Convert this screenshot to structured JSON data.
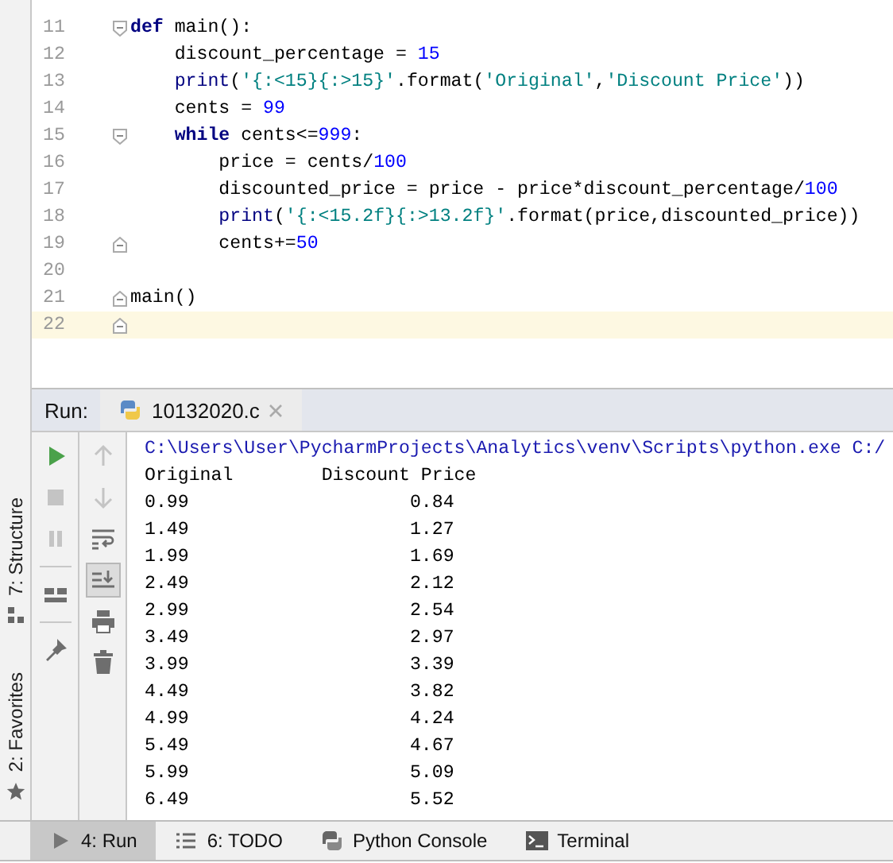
{
  "editor": {
    "lines": [
      {
        "number": "11",
        "fold_start": true,
        "fold_end": false,
        "current": false,
        "tokens": [
          {
            "kind": "keyword",
            "text": "def"
          },
          {
            "kind": "plain",
            "text": " main():"
          }
        ]
      },
      {
        "number": "12",
        "fold_start": false,
        "fold_end": false,
        "current": false,
        "tokens": [
          {
            "kind": "plain",
            "text": "    discount_percentage = "
          },
          {
            "kind": "number",
            "text": "15"
          }
        ]
      },
      {
        "number": "13",
        "fold_start": false,
        "fold_end": false,
        "current": false,
        "tokens": [
          {
            "kind": "builtin",
            "text": "    print"
          },
          {
            "kind": "plain",
            "text": "("
          },
          {
            "kind": "string",
            "text": "'{:<15}{:>15}'"
          },
          {
            "kind": "plain",
            "text": ".format("
          },
          {
            "kind": "string",
            "text": "'Original'"
          },
          {
            "kind": "plain",
            "text": ","
          },
          {
            "kind": "string",
            "text": "'Discount Price'"
          },
          {
            "kind": "plain",
            "text": "))"
          }
        ]
      },
      {
        "number": "14",
        "fold_start": false,
        "fold_end": false,
        "current": false,
        "tokens": [
          {
            "kind": "plain",
            "text": "    cents = "
          },
          {
            "kind": "number",
            "text": "99"
          }
        ]
      },
      {
        "number": "15",
        "fold_start": true,
        "fold_end": false,
        "current": false,
        "tokens": [
          {
            "kind": "keyword",
            "text": "    while"
          },
          {
            "kind": "plain",
            "text": " cents<="
          },
          {
            "kind": "number",
            "text": "999"
          },
          {
            "kind": "plain",
            "text": ":"
          }
        ]
      },
      {
        "number": "16",
        "fold_start": false,
        "fold_end": false,
        "current": false,
        "tokens": [
          {
            "kind": "plain",
            "text": "        price = cents/"
          },
          {
            "kind": "number",
            "text": "100"
          }
        ]
      },
      {
        "number": "17",
        "fold_start": false,
        "fold_end": false,
        "current": false,
        "tokens": [
          {
            "kind": "plain",
            "text": "        discounted_price = price - price*discount_percentage/"
          },
          {
            "kind": "number",
            "text": "100"
          }
        ]
      },
      {
        "number": "18",
        "fold_start": false,
        "fold_end": false,
        "current": false,
        "tokens": [
          {
            "kind": "builtin",
            "text": "        print"
          },
          {
            "kind": "plain",
            "text": "("
          },
          {
            "kind": "string",
            "text": "'{:<15.2f}{:>13.2f}'"
          },
          {
            "kind": "plain",
            "text": ".format(price,discounted_price))"
          }
        ]
      },
      {
        "number": "19",
        "fold_start": false,
        "fold_end": true,
        "current": false,
        "tokens": [
          {
            "kind": "plain",
            "text": "        cents+="
          },
          {
            "kind": "number",
            "text": "50"
          }
        ]
      },
      {
        "number": "20",
        "fold_start": false,
        "fold_end": false,
        "current": false
      },
      {
        "number": "21",
        "fold_start": false,
        "fold_end": true,
        "current": false,
        "tokens": [
          {
            "kind": "plain",
            "text": "main()"
          }
        ]
      },
      {
        "number": "22",
        "fold_start": false,
        "fold_end": true,
        "current": true
      }
    ]
  },
  "run_panel": {
    "label": "Run:",
    "tabs": [
      {
        "title": "10132020.c",
        "selected": true
      }
    ],
    "toolbar_left": [
      {
        "kind": "run",
        "disabled": false
      },
      {
        "kind": "stop",
        "disabled": true
      },
      {
        "kind": "pause",
        "disabled": true
      },
      {
        "kind": "layout",
        "disabled": false
      },
      {
        "kind": "pin",
        "disabled": false
      }
    ],
    "toolbar_right": [
      {
        "kind": "up",
        "disabled": true,
        "on": false
      },
      {
        "kind": "down",
        "disabled": true,
        "on": false
      },
      {
        "kind": "wrap",
        "disabled": false,
        "on": false
      },
      {
        "kind": "scroll-end",
        "disabled": false,
        "on": true
      },
      {
        "kind": "print",
        "disabled": false,
        "on": false
      },
      {
        "kind": "delete",
        "disabled": false,
        "on": false
      }
    ],
    "console": [
      {
        "kind": "command",
        "text": "C:\\Users\\User\\PycharmProjects\\Analytics\\venv\\Scripts\\python.exe C:/"
      },
      {
        "kind": "output",
        "text": "Original        Discount Price"
      },
      {
        "kind": "output",
        "text": "0.99                    0.84"
      },
      {
        "kind": "output",
        "text": "1.49                    1.27"
      },
      {
        "kind": "output",
        "text": "1.99                    1.69"
      },
      {
        "kind": "output",
        "text": "2.49                    2.12"
      },
      {
        "kind": "output",
        "text": "2.99                    2.54"
      },
      {
        "kind": "output",
        "text": "3.49                    2.97"
      },
      {
        "kind": "output",
        "text": "3.99                    3.39"
      },
      {
        "kind": "output",
        "text": "4.49                    3.82"
      },
      {
        "kind": "output",
        "text": "4.99                    4.24"
      },
      {
        "kind": "output",
        "text": "5.49                    4.67"
      },
      {
        "kind": "output",
        "text": "5.99                    5.09"
      },
      {
        "kind": "output",
        "text": "6.49                    5.52"
      }
    ]
  },
  "side_tools": [
    {
      "kind": "structure",
      "label": "7: Structure"
    },
    {
      "kind": "favorites",
      "label": "2: Favorites"
    }
  ],
  "bottom_tabs": [
    {
      "kind": "run",
      "label": "4: Run",
      "selected": true
    },
    {
      "kind": "todo",
      "label": "6: TODO",
      "selected": false
    },
    {
      "kind": "python",
      "label": "Python Console",
      "selected": false
    },
    {
      "kind": "terminal",
      "label": "Terminal",
      "selected": false
    }
  ]
}
